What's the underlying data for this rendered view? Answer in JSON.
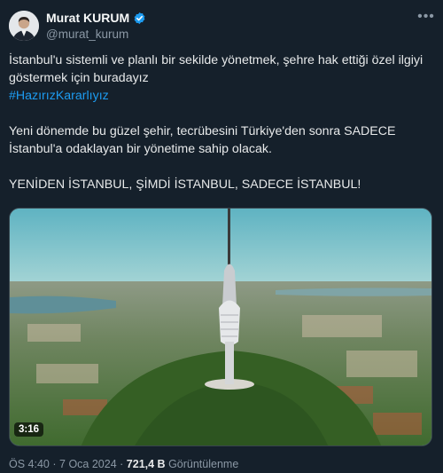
{
  "author": {
    "name": "Murat KURUM",
    "handle": "@murat_kurum",
    "verified": true
  },
  "tweet": {
    "paragraph1": "İstanbul'u sistemli ve planlı bir sekilde yönetmek, şehre hak ettiği özel ilgiyi göstermek için buradayız",
    "hashtag": "#HazırızKararlıyız",
    "paragraph2": "Yeni dönemde bu güzel şehir, tecrübesini Türkiye'den sonra SADECE İstanbul'a odaklayan bir yönetime sahip olacak.",
    "paragraph3": "YENİDEN İSTANBUL, ŞİMDİ İSTANBUL, SADECE İSTANBUL!"
  },
  "media": {
    "duration": "3:16",
    "subject": "aerial view of a tall TV tower on a forested hill over Istanbul"
  },
  "meta": {
    "time": "ÖS 4:40",
    "separator": "·",
    "date": "7 Oca 2024",
    "views_count": "721,4 B",
    "views_label": "Görüntülenme"
  },
  "colors": {
    "background": "#15202b",
    "text": "#e7e9ea",
    "secondary": "#8b98a5",
    "link": "#1d9bf0",
    "verified": "#1d9bf0"
  },
  "icons": [
    "verified-badge-icon",
    "more-options-icon"
  ]
}
